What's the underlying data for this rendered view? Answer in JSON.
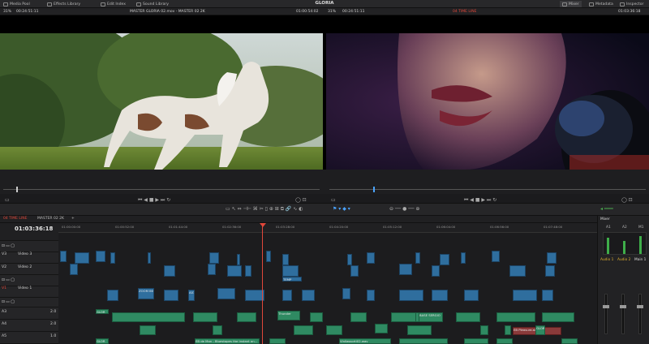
{
  "topbar": {
    "items": [
      "Media Pool",
      "Effects Library",
      "Edit Index",
      "Sound Library"
    ],
    "title": "GLORIA",
    "right": [
      "Mixer",
      "Metadata",
      "Inspector"
    ]
  },
  "viewerbar": {
    "zoom_left": "31%",
    "tc_left": "00:24:51:11",
    "clip_left": "MASTER GLORIA 02.mov - MASTER 02 2K",
    "tc_left2": "01:00:54:02",
    "zoom_right": "31%",
    "tc_right": "00:24:51:11",
    "timeline_right": "04 TIME LINE",
    "tc_right2": "01:03:36:18"
  },
  "timeline": {
    "timecode": "01:03:36:18",
    "tabs": [
      "04 TIME LINE",
      "MASTER 02 2K"
    ],
    "ruler": [
      "01:00:00:00",
      "01:00:52:00",
      "01:01:44:00",
      "01:02:36:00",
      "01:03:28:00",
      "01:04:20:00",
      "01:05:12:00",
      "01:06:04:00",
      "01:06:56:00",
      "01:07:48:00"
    ],
    "tracks": [
      {
        "id": "V3",
        "name": "Video 3"
      },
      {
        "id": "V2",
        "name": "Video 2"
      },
      {
        "id": "V1",
        "name": "Video 1"
      },
      {
        "id": "A3",
        "gain": "2.0"
      },
      {
        "id": "A4",
        "gain": "2.0"
      },
      {
        "id": "A5",
        "gain": "1.0"
      }
    ],
    "clip_labels": [
      "GLOR",
      "ZOOM INS",
      "A03",
      "TEMP",
      "Thunder",
      "BASE SERGIO",
      "EB de Man - Bluestopes the instant on...",
      "Vinilassorti02.wav",
      "EB Pleasure.aiff",
      "GLOR"
    ]
  },
  "mixer": {
    "title": "Mixer",
    "channels": [
      "A1",
      "A2",
      "M1"
    ],
    "buses": [
      "Audio 1",
      "Audio 2",
      "Main 1"
    ]
  }
}
